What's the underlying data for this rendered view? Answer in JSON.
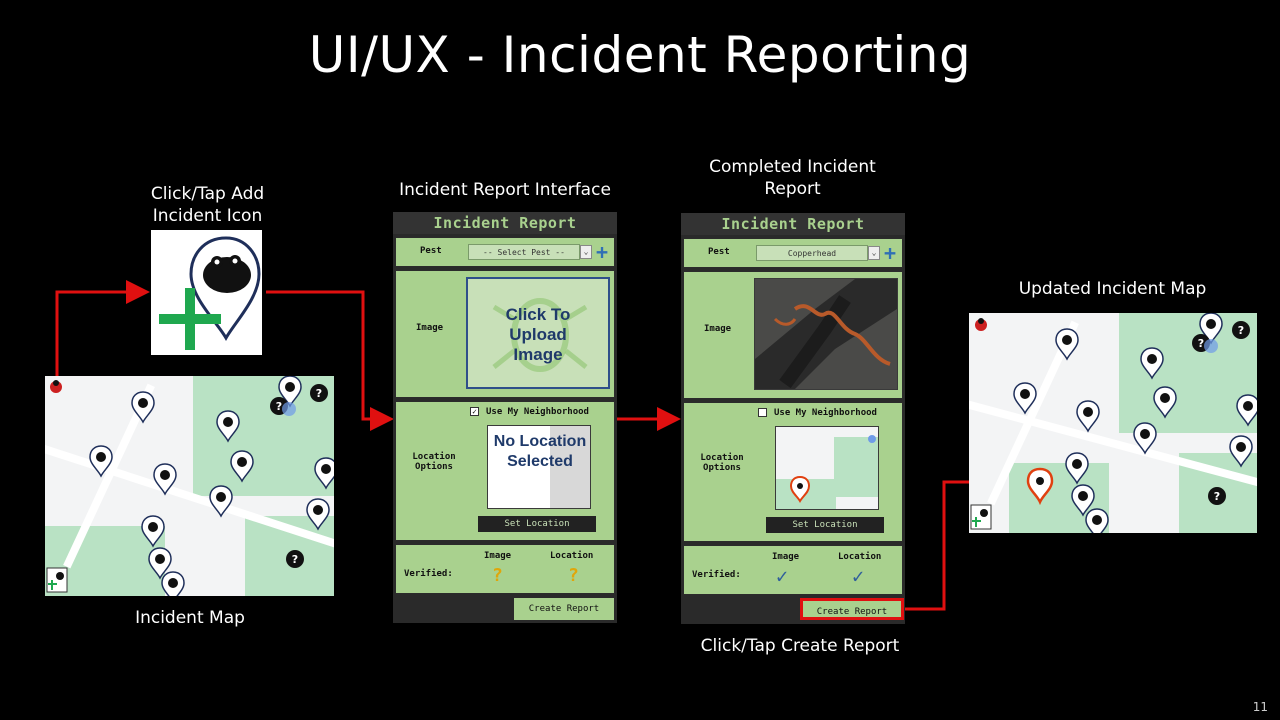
{
  "slide": {
    "title": "UI/UX - Incident Reporting",
    "page_number": "11"
  },
  "captions": {
    "add_icon": "Click/Tap Add Incident Icon",
    "interface": "Incident Report Interface",
    "completed": "Completed Incident Report",
    "updated_map": "Updated Incident Map",
    "incident_map": "Incident Map",
    "create_report": "Click/Tap Create Report"
  },
  "form_empty": {
    "header": "Incident Report",
    "pest_label": "Pest",
    "pest_value": "-- Select Pest --",
    "image_label": "Image",
    "upload_text": "Click To Upload Image",
    "neighborhood_label": "Use My Neighborhood",
    "neighborhood_checked": true,
    "location_label": "Location Options",
    "no_location_text": "No Location Selected",
    "set_location": "Set Location",
    "verified_label": "Verified:",
    "image_col": "Image",
    "location_col": "Location",
    "image_status": "?",
    "location_status": "?",
    "create_button": "Create Report"
  },
  "form_complete": {
    "header": "Incident Report",
    "pest_label": "Pest",
    "pest_value": "Copperhead",
    "image_label": "Image",
    "neighborhood_label": "Use My Neighborhood",
    "neighborhood_checked": false,
    "location_label": "Location Options",
    "set_location": "Set Location",
    "verified_label": "Verified:",
    "image_col": "Image",
    "location_col": "Location",
    "image_status": "✓",
    "location_status": "✓",
    "create_button": "Create Report"
  },
  "colors": {
    "form_green": "#a9d18e",
    "arrow_red": "#e01010",
    "accent_blue": "#2f6fb5",
    "question_yellow": "#e0a60a"
  },
  "icons": {
    "add_incident": "frog-pin-with-plus-icon",
    "map_pins": "animal-location-pin-icons",
    "unknown_pin": "question-pin-icon",
    "bug_logo": "ladybug-icon"
  }
}
